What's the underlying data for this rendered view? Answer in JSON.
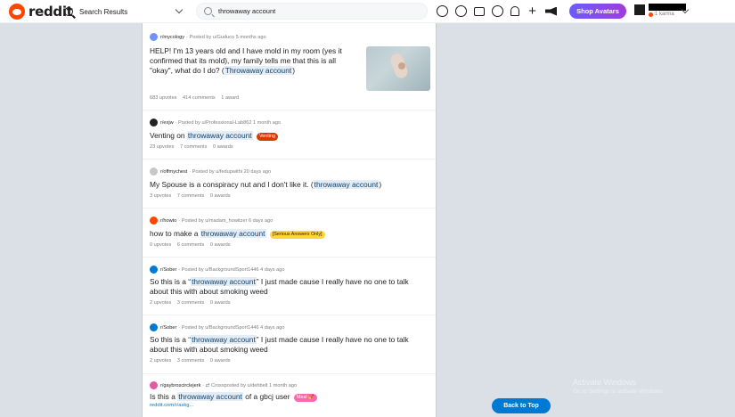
{
  "header": {
    "brand": "reddit",
    "home_label": "Search Results",
    "search_value": "throwaway account",
    "shop_label": "Shop Avatars",
    "karma": "1 karma"
  },
  "posts": [
    {
      "sub": "r/mycology",
      "byline": "· Posted by u/Guduco 5 months ago",
      "title_plain": "HELP! I'm 13 years old and I have mold in my room (yes it confirmed that its mold), my family tells me that this is all \"okay\", what do I do? (",
      "title_hl": "Throwaway account",
      "title_after": ")",
      "upvotes": "683 upvotes",
      "comments": "414 comments",
      "awards": "1 award",
      "sub_color": "#7193ff"
    },
    {
      "sub": "r/exjw",
      "byline": "· Posted by u/Professional-Lab862 1 month ago",
      "title_plain": "Venting on ",
      "title_hl": "throwaway account",
      "title_after": "",
      "flair": "Venting",
      "flair_bg": "#d93a00",
      "flair_color": "#ffffff",
      "upvotes": "23 upvotes",
      "comments": "7 comments",
      "awards": "0 awards",
      "sub_color": "#222222"
    },
    {
      "sub": "r/offmychest",
      "byline": "· Posted by u/fedupwithi 20 days ago",
      "title_plain": "My Spouse is a conspiracy nut and I don't like it. (",
      "title_hl": "throwaway account",
      "title_after": ")",
      "upvotes": "3 upvotes",
      "comments": "7 comments",
      "awards": "0 awards",
      "sub_color": "#c7c7c7"
    },
    {
      "sub": "r/howto",
      "byline": "· Posted by u/madam_howitzer 6 days ago",
      "title_plain": "how to make a ",
      "title_hl": "throwaway account",
      "title_after": "",
      "flair": "[Serious Answers Only]",
      "flair_bg": "#ffd635",
      "flair_color": "#1c1c1c",
      "upvotes": "0 upvotes",
      "comments": "6 comments",
      "awards": "0 awards",
      "sub_color": "#ff4500"
    },
    {
      "sub": "r/Sober",
      "byline": "· Posted by u/BackgroundSport1446 4 days ago",
      "title_plain": "So this is a “",
      "title_hl": "throwaway account",
      "title_after": "” I just made cause I really have no one to talk about this with about smoking weed",
      "upvotes": "2 upvotes",
      "comments": "3 comments",
      "awards": "0 awards",
      "sub_color": "#0079d3"
    },
    {
      "sub": "r/Sober",
      "byline": "· Posted by u/BackgroundSport1446 4 days ago",
      "title_plain": "So this is a “",
      "title_hl": "throwaway account",
      "title_after": "” I just made cause I really have no one to talk about this with about smoking weed",
      "upvotes": "2 upvotes",
      "comments": "3 comments",
      "awards": "0 awards",
      "sub_color": "#0079d3"
    },
    {
      "sub": "r/gaybroscirclejerk",
      "byline": "· ⇄ Crossposted by u/dehbelt 1 month ago",
      "title_plain": "Is this a ",
      "title_hl": "throwaway account",
      "title_after": " of a gbcj user",
      "flair": "Meal 💅",
      "flair_bg": "#ff66ac",
      "flair_color": "#ffffff",
      "link": "reddit.com/r/askg...",
      "sub_color": "#e05ca0"
    }
  ],
  "back_to_top": "Back to Top",
  "watermark": {
    "title": "Activate Windows",
    "sub": "Go to Settings to activate Windows."
  }
}
